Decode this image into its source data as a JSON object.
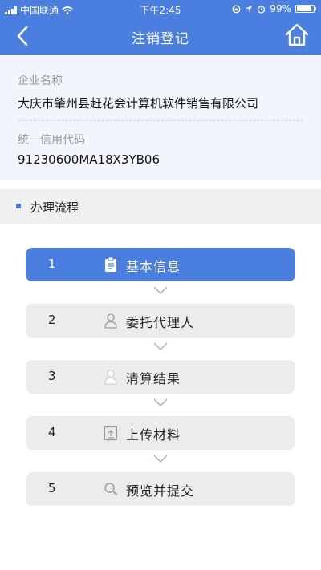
{
  "status_bar": {
    "carrier": "中国联通",
    "time": "下午2:45",
    "battery": "99%"
  },
  "nav": {
    "title": "注销登记"
  },
  "company": {
    "name_label": "企业名称",
    "name_value": "大庆市肇州县赶花会计算机软件销售有限公司",
    "code_label": "统一信用代码",
    "code_value": "91230600MA18X3YB06"
  },
  "section": {
    "title": "办理流程"
  },
  "steps": [
    {
      "num": "1",
      "label": "基本信息",
      "icon": "clipboard-icon",
      "active": true
    },
    {
      "num": "2",
      "label": "委托代理人",
      "icon": "person-outline-icon",
      "active": false
    },
    {
      "num": "3",
      "label": "清算结果",
      "icon": "person-filled-icon",
      "active": false
    },
    {
      "num": "4",
      "label": "上传材料",
      "icon": "upload-icon",
      "active": false
    },
    {
      "num": "5",
      "label": "预览并提交",
      "icon": "search-icon",
      "active": false
    }
  ],
  "colors": {
    "primary": "#4a7fe0",
    "step_inactive": "#ececec",
    "info_bg": "#f2f5fb"
  }
}
